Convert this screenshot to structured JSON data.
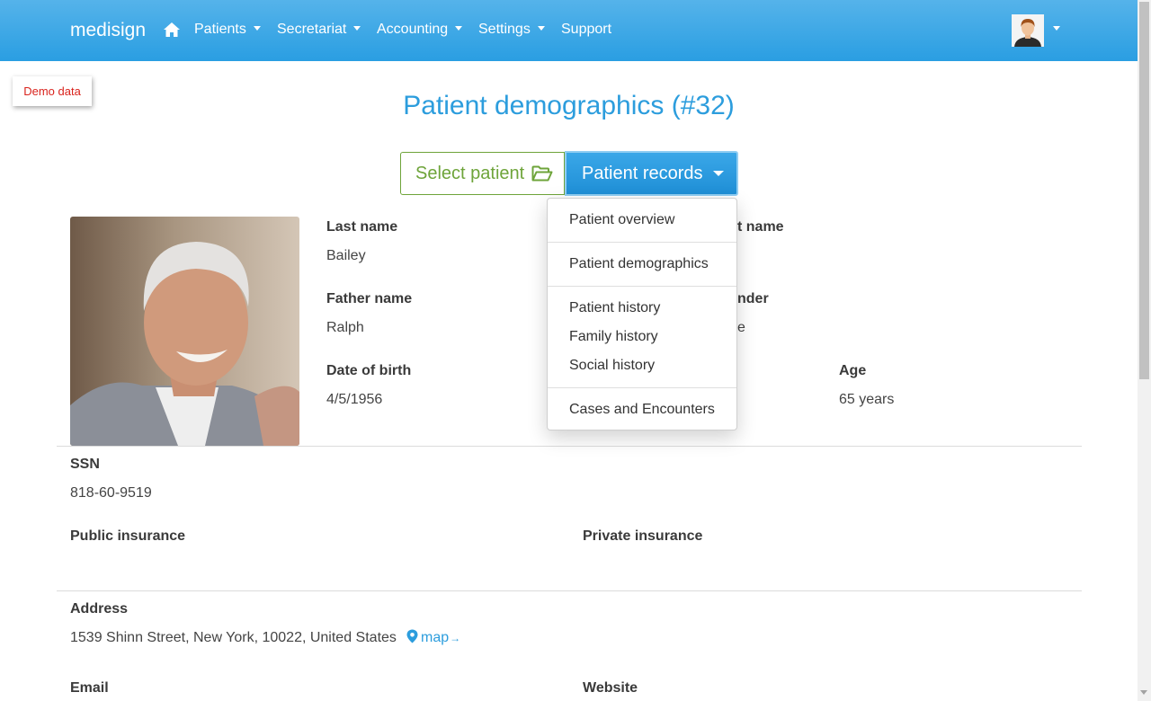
{
  "navbar": {
    "brand": "medisign",
    "items": [
      "Patients",
      "Secretariat",
      "Accounting",
      "Settings"
    ],
    "support": "Support"
  },
  "badge": {
    "demo": "Demo data"
  },
  "page": {
    "title": "Patient demographics (#32)"
  },
  "buttons": {
    "select_patient": "Select patient",
    "patient_records": "Patient records"
  },
  "patient": {
    "last_name_label": "Last name",
    "last_name": "Bailey",
    "first_name_label_partial": "t name",
    "father_name_label": "Father name",
    "father_name": "Ralph",
    "gender_label_partial": "nder",
    "gender_value_partial": "e",
    "dob_label": "Date of birth",
    "dob": "4/5/1956",
    "age_label": "Age",
    "age": "65 years",
    "ssn_label": "SSN",
    "ssn": "818-60-9519",
    "public_insurance_label": "Public insurance",
    "private_insurance_label": "Private insurance",
    "address_label": "Address",
    "address": "1539 Shinn Street, New York, 10022, United States",
    "map_link": "map",
    "email_label": "Email",
    "website_label": "Website"
  },
  "dropdown": {
    "overview": "Patient overview",
    "demographics": "Patient demographics",
    "history": "Patient history",
    "family_history": "Family history",
    "social_history": "Social history",
    "cases": "Cases and Encounters"
  },
  "colors": {
    "accent": "#2c9ddd",
    "success": "#6ea43a",
    "demo": "#d9231d"
  }
}
